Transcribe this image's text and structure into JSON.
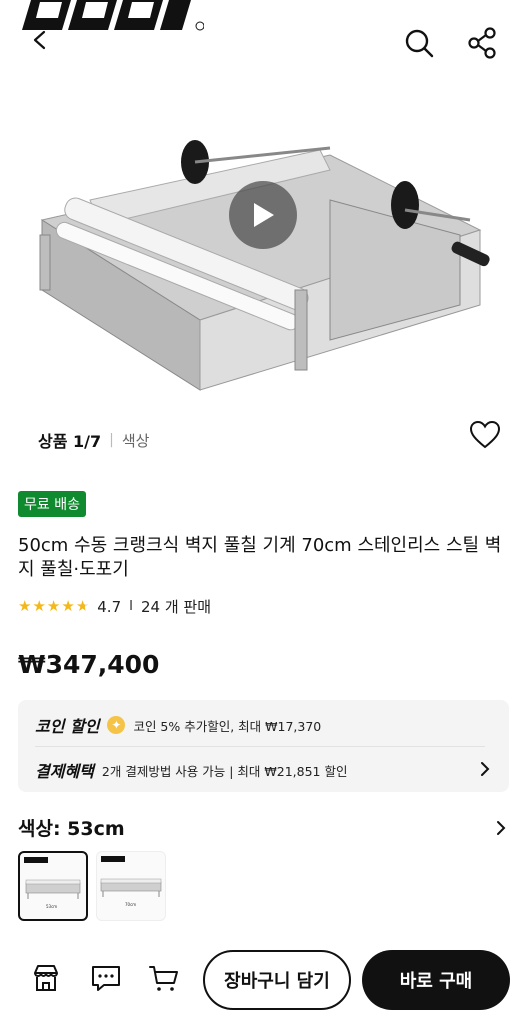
{
  "header": {
    "back_icon": "chevron-left-icon",
    "search_icon": "search-icon",
    "share_icon": "share-icon"
  },
  "gallery": {
    "play_icon": "play-icon",
    "counter_label": "상품 1/7",
    "counter_sep": "|",
    "color_link": "색상"
  },
  "product": {
    "free_shipping_badge": "무료 배송",
    "title": "50cm 수동 크랭크식 벽지 풀칠 기계 70cm 스테인리스 스틸 벽지 풀칠·도포기",
    "rating": "4.7",
    "rating_sep": "I",
    "sold": "24 개 판매",
    "stars": 4.7,
    "price": "₩347,400"
  },
  "promo": {
    "coin_title": "코인 할인",
    "coin_text": "코인 5% 추가할인, 최대 ₩17,370",
    "payment_title": "결제혜택",
    "payment_text": "2개 결제방법 사용 가능 | 최대 ₩21,851 할인"
  },
  "options": {
    "color_label": "색상: 53cm",
    "thumbs": [
      {
        "label": "53cm",
        "selected": true
      },
      {
        "label": "70cm",
        "selected": false
      }
    ]
  },
  "bottom_bar": {
    "store_icon": "store-icon",
    "chat_icon": "chat-icon",
    "cart_icon": "cart-icon",
    "cart_label": "장바구니 담기",
    "buy_label": "바로 구매"
  },
  "colors": {
    "free_shipping_green": "#0f8a2e",
    "star": "#f3b81b",
    "buy_button": "#111111"
  }
}
